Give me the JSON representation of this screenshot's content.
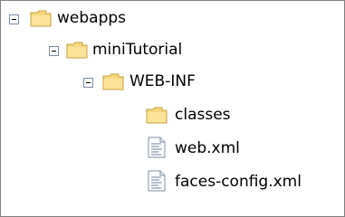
{
  "tree": {
    "nodes": [
      {
        "label": "webapps",
        "icon": "folder-icon",
        "expanded": true
      },
      {
        "label": "miniTutorial",
        "icon": "folder-icon",
        "expanded": true
      },
      {
        "label": "WEB-INF",
        "icon": "folder-icon",
        "expanded": true
      },
      {
        "label": "classes",
        "icon": "folder-icon"
      },
      {
        "label": "web.xml",
        "icon": "xml-file-icon"
      },
      {
        "label": "faces-config.xml",
        "icon": "xml-file-icon"
      }
    ]
  },
  "colors": {
    "folder_fill": "#f5d67b",
    "folder_stroke": "#c8a23c",
    "toggle_border": "#7a8ea8",
    "panel_border": "#808080"
  }
}
